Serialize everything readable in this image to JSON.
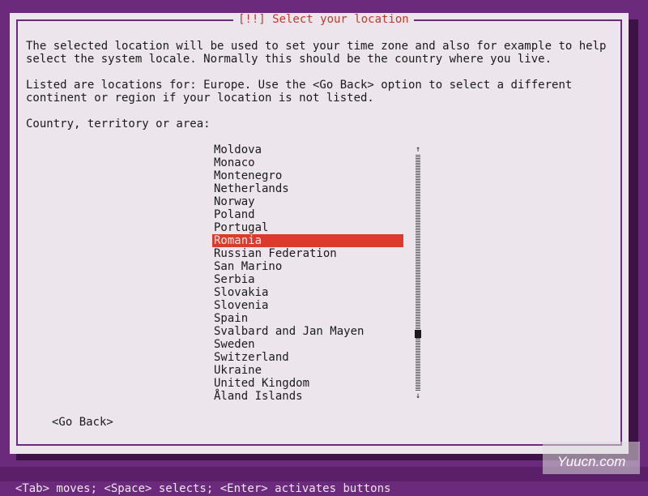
{
  "dialog": {
    "title": "[!!] Select your location",
    "description_1": "The selected location will be used to set your time zone and also for example to help\nselect the system locale. Normally this should be the country where you live.",
    "description_2": "Listed are locations for: Europe. Use the <Go Back> option to select a different\ncontinent or region if your location is not listed.",
    "prompt": "Country, territory or area:",
    "countries": [
      "Moldova",
      "Monaco",
      "Montenegro",
      "Netherlands",
      "Norway",
      "Poland",
      "Portugal",
      "Romania",
      "Russian Federation",
      "San Marino",
      "Serbia",
      "Slovakia",
      "Slovenia",
      "Spain",
      "Svalbard and Jan Mayen",
      "Sweden",
      "Switzerland",
      "Ukraine",
      "United Kingdom",
      "Åland Islands"
    ],
    "selected_country": "Romania",
    "go_back_label": "<Go Back>",
    "scroll_up_glyph": "↑",
    "scroll_down_glyph": "↓"
  },
  "status_bar": {
    "text": "<Tab> moves; <Space> selects; <Enter> activates buttons"
  },
  "watermark": {
    "text": "Yuucn.com"
  },
  "colors": {
    "background": "#6b2a7b",
    "dialog_bg": "#ece6ec",
    "title": "#c0392b",
    "selection": "#dc3b2b",
    "status_bar_bg": "#5a1f68"
  }
}
